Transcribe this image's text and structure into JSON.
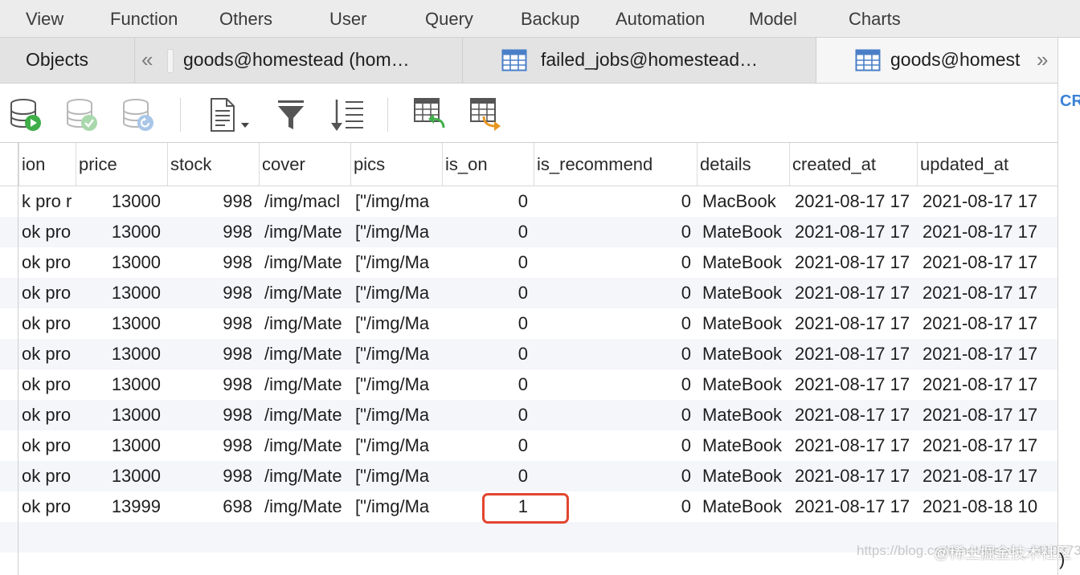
{
  "menu": [
    "View",
    "Function",
    "Others",
    "User",
    "Query",
    "Backup",
    "Automation",
    "Model",
    "Charts"
  ],
  "tabs": {
    "objects": "Objects",
    "nav_back_icon": "double-chevron-left-icon",
    "nav_forward_icon": "double-chevron-right-icon",
    "tab1": "goods@homestead (hom…",
    "tab2": "failed_jobs@homestead…",
    "tab3": "goods@homest"
  },
  "right_strip": {
    "label": "CR"
  },
  "toolbar": {
    "icons": [
      "begin-transaction-icon",
      "commit-icon",
      "rollback-icon",
      "text-view-icon",
      "filter-icon",
      "sort-icon",
      "import-icon",
      "export-icon"
    ]
  },
  "grid": {
    "columns": [
      "ion",
      "price",
      "stock",
      "cover",
      "pics",
      "is_on",
      "is_recommend",
      "details",
      "created_at",
      "updated_at"
    ],
    "rows": [
      [
        "k pro r",
        "13000",
        "998",
        "/img/macl",
        "[\"/img/ma",
        "0",
        "0",
        "MacBook",
        "2021-08-17 17",
        "2021-08-17 17"
      ],
      [
        "ok pro",
        "13000",
        "998",
        "/img/Mate",
        "[\"/img/Ma",
        "0",
        "0",
        "MateBook",
        "2021-08-17 17",
        "2021-08-17 17"
      ],
      [
        "ok pro",
        "13000",
        "998",
        "/img/Mate",
        "[\"/img/Ma",
        "0",
        "0",
        "MateBook",
        "2021-08-17 17",
        "2021-08-17 17"
      ],
      [
        "ok pro",
        "13000",
        "998",
        "/img/Mate",
        "[\"/img/Ma",
        "0",
        "0",
        "MateBook",
        "2021-08-17 17",
        "2021-08-17 17"
      ],
      [
        "ok pro",
        "13000",
        "998",
        "/img/Mate",
        "[\"/img/Ma",
        "0",
        "0",
        "MateBook",
        "2021-08-17 17",
        "2021-08-17 17"
      ],
      [
        "ok pro",
        "13000",
        "998",
        "/img/Mate",
        "[\"/img/Ma",
        "0",
        "0",
        "MateBook",
        "2021-08-17 17",
        "2021-08-17 17"
      ],
      [
        "ok pro",
        "13000",
        "998",
        "/img/Mate",
        "[\"/img/Ma",
        "0",
        "0",
        "MateBook",
        "2021-08-17 17",
        "2021-08-17 17"
      ],
      [
        "ok pro",
        "13000",
        "998",
        "/img/Mate",
        "[\"/img/Ma",
        "0",
        "0",
        "MateBook",
        "2021-08-17 17",
        "2021-08-17 17"
      ],
      [
        "ok pro",
        "13000",
        "998",
        "/img/Mate",
        "[\"/img/Ma",
        "0",
        "0",
        "MateBook",
        "2021-08-17 17",
        "2021-08-17 17"
      ],
      [
        "ok pro",
        "13000",
        "998",
        "/img/Mate",
        "[\"/img/Ma",
        "0",
        "0",
        "MateBook",
        "2021-08-17 17",
        "2021-08-17 17"
      ],
      [
        "ok pro",
        "13999",
        "698",
        "/img/Mate",
        "[\"/img/Ma",
        "1",
        "0",
        "MateBook",
        "2021-08-17 17",
        "2021-08-18 10"
      ]
    ],
    "highlight_color": "#e2452f"
  },
  "watermark": {
    "url": "https://blog.csdn.net/weixin_44103733",
    "site": "@稀土掘金技术社区"
  },
  "stray_char": ")"
}
